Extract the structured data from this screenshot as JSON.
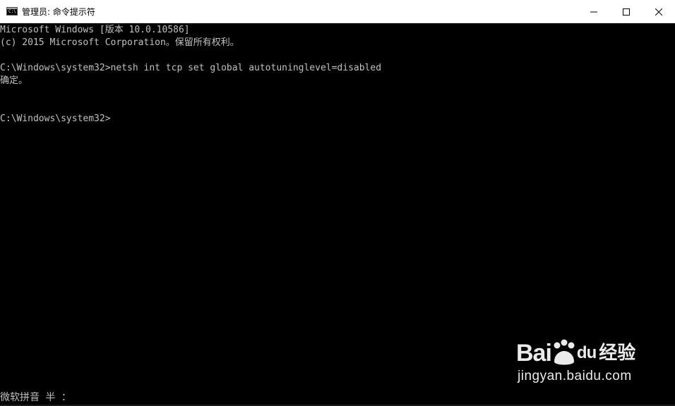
{
  "window": {
    "title": "管理员: 命令提示符",
    "icon": "cmd-icon",
    "controls": [
      "minimize-icon",
      "maximize-icon",
      "close-icon"
    ]
  },
  "console": {
    "lines": [
      "Microsoft Windows [版本 10.0.10586]",
      "(c) 2015 Microsoft Corporation。保留所有权利。",
      "",
      "C:\\Windows\\system32>netsh int tcp set global autotuninglevel=disabled",
      "确定。",
      "",
      "",
      "C:\\Windows\\system32>"
    ]
  },
  "ime": {
    "status": "微软拼音 半 ："
  },
  "watermark": {
    "brand": "Bai",
    "brand_suffix": "du",
    "brand_zh": "经验",
    "url": "jingyan.baidu.com"
  },
  "colors": {
    "console_bg": "#000000",
    "console_text": "#c0c0c0",
    "titlebar_bg": "#ffffff"
  }
}
